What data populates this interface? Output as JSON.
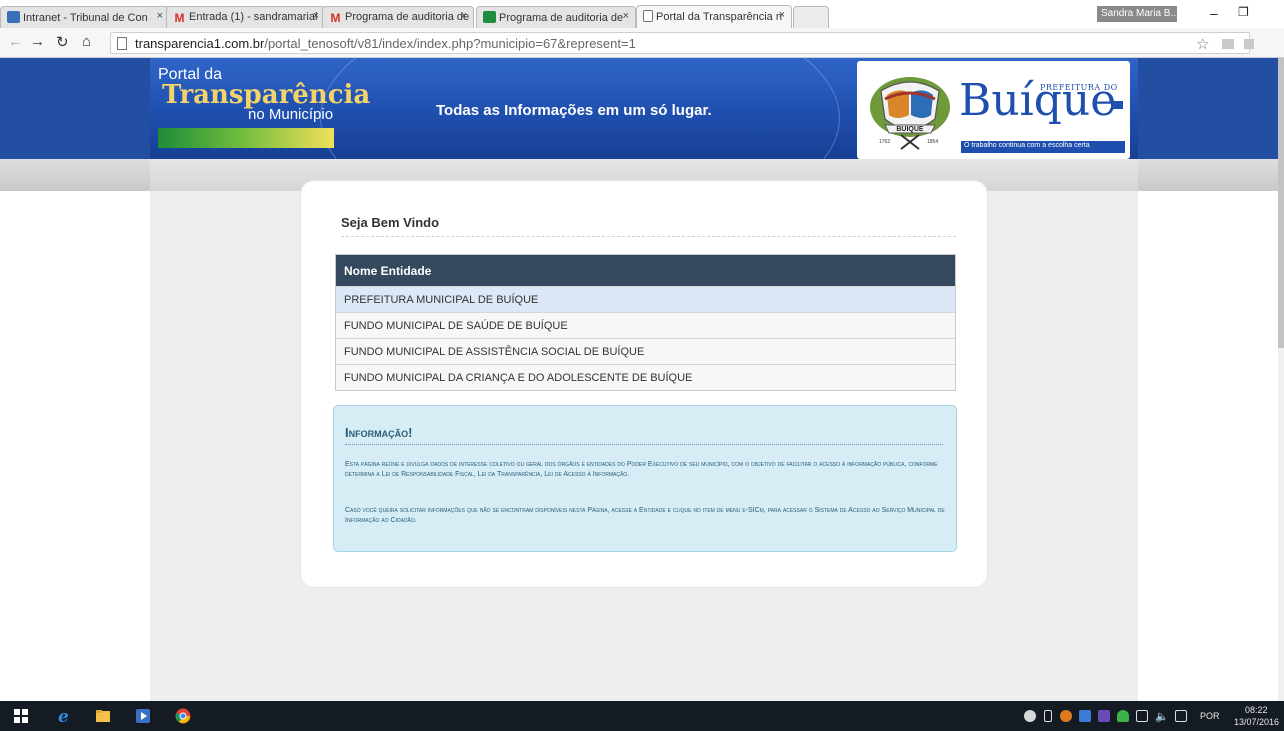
{
  "browser": {
    "tabs": [
      {
        "label": "Intranet - Tribunal de Con",
        "icon": "intranet-icon"
      },
      {
        "label": "Entrada (1) - sandramarial",
        "icon": "gmail-icon"
      },
      {
        "label": "Programa de auditoria de",
        "icon": "gmail-icon"
      },
      {
        "label": "Programa de auditoria de",
        "icon": "sheets-icon"
      },
      {
        "label": "Portal da Transparência n",
        "icon": "page-icon"
      }
    ],
    "close_glyph": "×",
    "user": "Sandra Maria B...",
    "url_host": "transparencia1.com.br",
    "url_path": "/portal_tenosoft/v81/index/index.php?municipio=67&represent=1"
  },
  "header": {
    "portal_line1": "Portal da",
    "portal_line2": "Transparência",
    "portal_line3": "no Município",
    "tagline": "Todas as Informações em um só lugar.",
    "brand_prefix": "PREFEITURA DO",
    "brand_name": "Buíque",
    "brand_slogan": "O trabalho continua com a escolha certa",
    "crest_banner": "BUÍQUE",
    "crest_year_left": "1762",
    "crest_year_right": "1854"
  },
  "welcome": "Seja Bem Vindo",
  "entities": {
    "header": "Nome Entidade",
    "rows": [
      "PREFEITURA MUNICIPAL DE BUÍQUE",
      "FUNDO MUNICIPAL DE SAÚDE DE BUÍQUE",
      "FUNDO MUNICIPAL DE ASSISTÊNCIA SOCIAL DE BUÍQUE",
      "FUNDO MUNICIPAL DA CRIANÇA E DO ADOLESCENTE DE BUÍQUE"
    ]
  },
  "info": {
    "title": "Informação!",
    "p1": "Esta página reúne e divulga dados de interesse coletivo ou geral dos órgãos e entidades do Poder Executivo de seu município, com o objetivo de facilitar o acesso à informação pública, conforme determina a Lei de Responsabilidade Fiscal, Lei da Transparência, Lei de Acesso à Informação.",
    "p2": "Caso você queira solicitar informações que não se encontram disponíveis nesta Página, acesse a Entidade e clique no item de menu e-SICm, para acessar o Sistema de Acesso ao Serviço Municipal de Informação ao Cidadão."
  },
  "taskbar": {
    "lang": "POR",
    "time": "08:22",
    "date": "13/07/2016"
  },
  "colors": {
    "header_blue": "#1f4fae",
    "table_header": "#34495e",
    "selected_row": "#dde8f6",
    "info_bg": "#d6edf6",
    "info_text": "#2b5c78"
  }
}
